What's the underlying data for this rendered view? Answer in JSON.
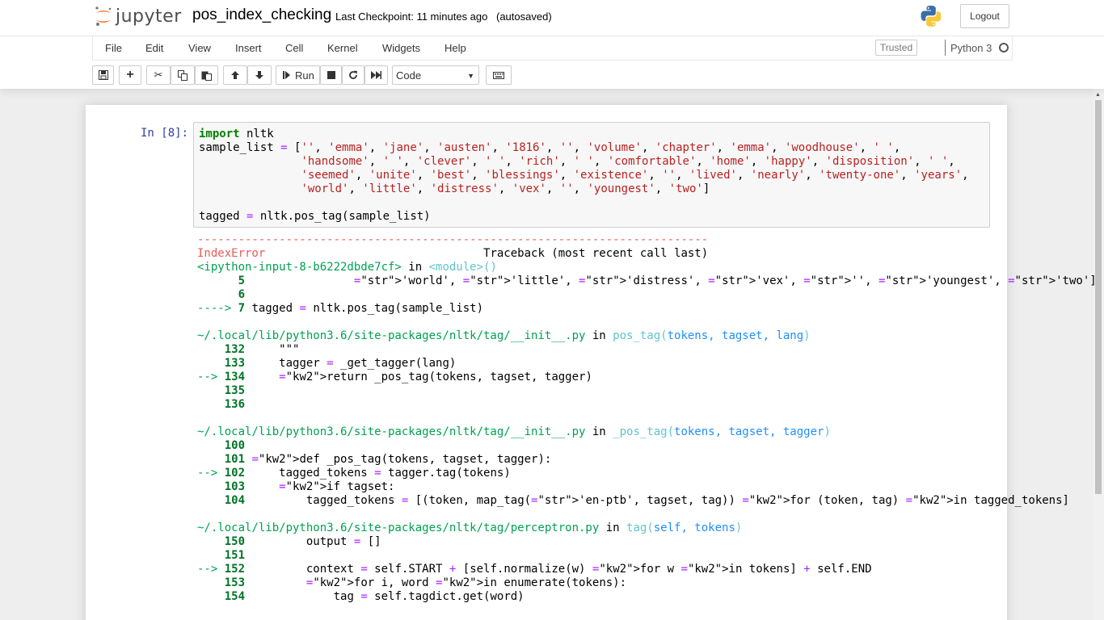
{
  "header": {
    "brand": "jupyter",
    "notebook_name": "pos_index_checking",
    "checkpoint": "Last Checkpoint: 11 minutes ago",
    "autosave": "(autosaved)",
    "logout": "Logout"
  },
  "menu": {
    "items": [
      "File",
      "Edit",
      "View",
      "Insert",
      "Cell",
      "Kernel",
      "Widgets",
      "Help"
    ],
    "trusted": "Trusted",
    "kernel": "Python 3"
  },
  "toolbar": {
    "run": "Run",
    "cell_type": "Code"
  },
  "cell": {
    "prompt": "In [8]:",
    "code": [
      "import nltk",
      "sample_list = ['', 'emma', 'jane', 'austen', '1816', '', 'volume', 'chapter', 'emma', 'woodhouse', ' ',",
      "               'handsome', ' ', 'clever', ' ', 'rich', ' ', 'comfortable', 'home', 'happy', 'disposition', ' ',",
      "               'seemed', 'unite', 'best', 'blessings', 'existence', '', 'lived', 'nearly', 'twenty-one', 'years',",
      "               'world', 'little', 'distress', 'vex', '', 'youngest', 'two']",
      "",
      "tagged = nltk.pos_tag(sample_list)"
    ]
  },
  "output": {
    "lines": [
      "---------------------------------------------------------------------------",
      "IndexError                                Traceback (most recent call last)",
      "<ipython-input-8-b6222dbde7cf> in <module>()",
      "      5                'world', 'little', 'distress', 'vex', '', 'youngest', 'two']",
      "      6 ",
      "----> 7 tagged = nltk.pos_tag(sample_list)",
      "",
      "~/.local/lib/python3.6/site-packages/nltk/tag/__init__.py in pos_tag(tokens, tagset, lang)",
      "    132     \"\"\"",
      "    133     tagger = _get_tagger(lang)",
      "--> 134     return _pos_tag(tokens, tagset, tagger)",
      "    135 ",
      "    136 ",
      "",
      "~/.local/lib/python3.6/site-packages/nltk/tag/__init__.py in _pos_tag(tokens, tagset, tagger)",
      "    100 ",
      "    101 def _pos_tag(tokens, tagset, tagger):",
      "--> 102     tagged_tokens = tagger.tag(tokens)",
      "    103     if tagset:",
      "    104         tagged_tokens = [(token, map_tag('en-ptb', tagset, tag)) for (token, tag) in tagged_tokens]",
      "",
      "~/.local/lib/python3.6/site-packages/nltk/tag/perceptron.py in tag(self, tokens)",
      "    150         output = []",
      "    151 ",
      "--> 152         context = self.START + [self.normalize(w) for w in tokens] + self.END",
      "    153         for i, word in enumerate(tokens):",
      "    154             tag = self.tagdict.get(word)"
    ]
  },
  "colors": {
    "prompt": "#303f9f",
    "keyword": "#008000",
    "string": "#ba2121",
    "error_red": "#e75c58",
    "error_green": "#00a250",
    "error_cyan": "#60c6c8",
    "error_blue": "#208ffb"
  }
}
